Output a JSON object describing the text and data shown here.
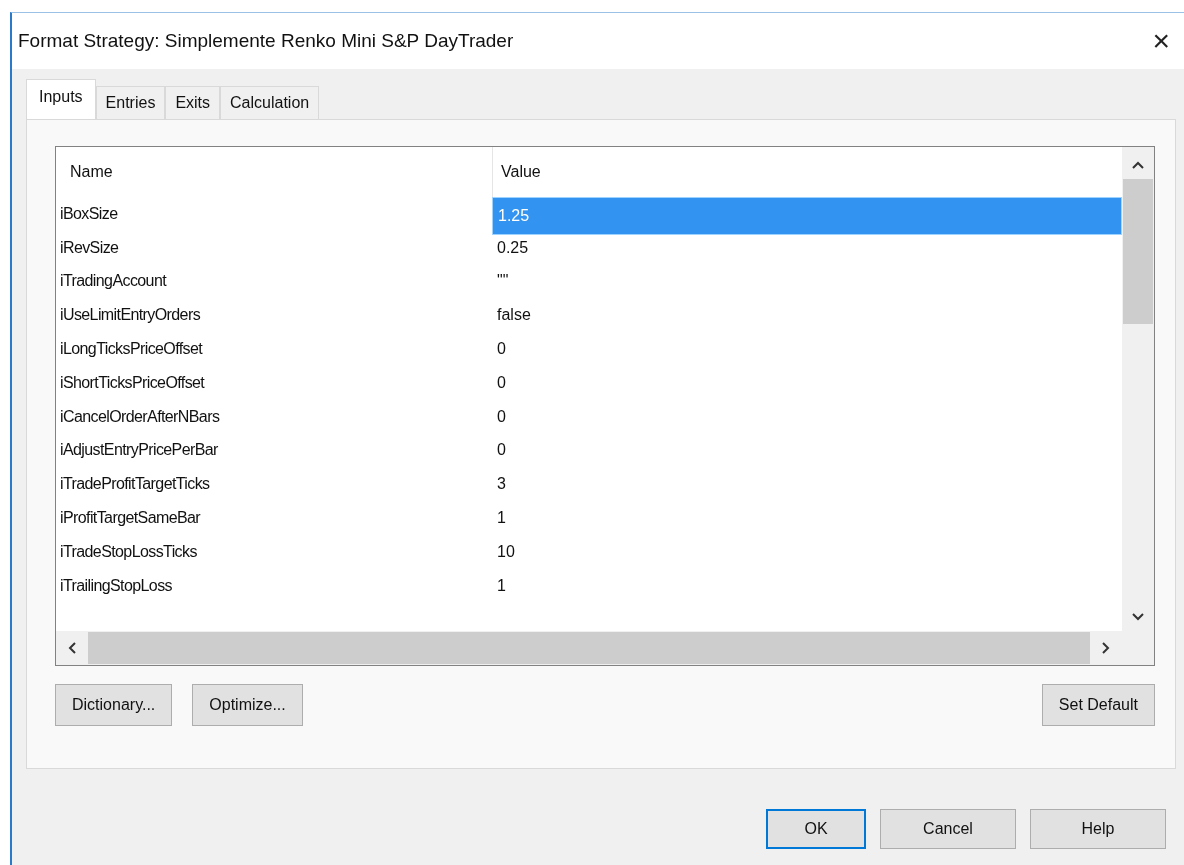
{
  "window": {
    "title": "Format Strategy: Simplemente Renko Mini S&P DayTrader",
    "close": "×"
  },
  "tabs": [
    {
      "label": "Inputs",
      "selected": true
    },
    {
      "label": "Entries",
      "selected": false
    },
    {
      "label": "Exits",
      "selected": false
    },
    {
      "label": "Calculation",
      "selected": false
    }
  ],
  "table": {
    "columns": [
      "Name",
      "Value"
    ],
    "rows": [
      {
        "name": "iBoxSize",
        "value": "1.25",
        "selected": true
      },
      {
        "name": "iRevSize",
        "value": "0.25",
        "selected": false
      },
      {
        "name": "iTradingAccount",
        "value": "\"\"",
        "selected": false
      },
      {
        "name": "iUseLimitEntryOrders",
        "value": "false",
        "selected": false
      },
      {
        "name": "iLongTicksPriceOffset",
        "value": "0",
        "selected": false
      },
      {
        "name": "iShortTicksPriceOffset",
        "value": "0",
        "selected": false
      },
      {
        "name": "iCancelOrderAfterNBars",
        "value": "0",
        "selected": false
      },
      {
        "name": "iAdjustEntryPricePerBar",
        "value": "0",
        "selected": false
      },
      {
        "name": "iTradeProfitTargetTicks",
        "value": "3",
        "selected": false
      },
      {
        "name": "iProfitTargetSameBar",
        "value": "1",
        "selected": false
      },
      {
        "name": "iTradeStopLossTicks",
        "value": "10",
        "selected": false
      },
      {
        "name": "iTrailingStopLoss",
        "value": "1",
        "selected": false
      }
    ]
  },
  "panel_buttons": [
    "Dictionary...",
    "Optimize...",
    "Set Default"
  ],
  "dialog_buttons": [
    {
      "label": "OK",
      "default": true
    },
    {
      "label": "Cancel",
      "default": false
    },
    {
      "label": "Help",
      "default": false
    }
  ]
}
